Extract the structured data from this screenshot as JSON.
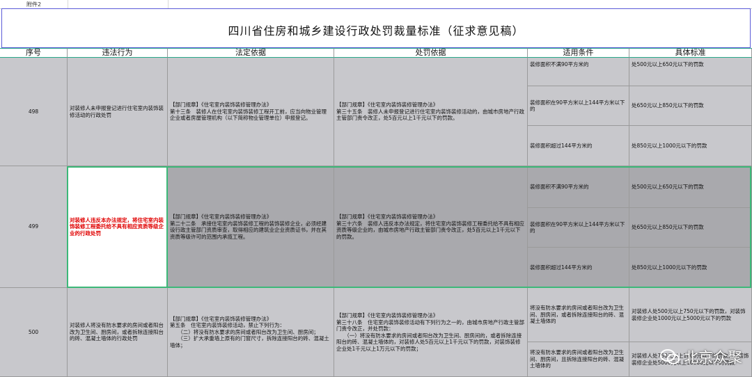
{
  "attachment_label": "附件2",
  "title": "四川省住房和城乡建设行政处罚裁量标准（征求意见稿）",
  "headers": [
    "序号",
    "违法行为",
    "法定依据",
    "处罚依据",
    "适用条件",
    "具体标准"
  ],
  "rows": [
    {
      "no": "498",
      "violation": "对装修人未申报登记进行住宅室内装饰装修活动的行政处罚",
      "legal_basis": "【部门规章】《住宅室内装饰装修管理办法》\n第十三条　装修人在住宅室内装饰装修工程开工前，应当向物业管理企业或者房屋管理机构（以下简称物业管理单位）申报登记。",
      "penalty_basis": "【部门规章】《住宅室内装饰装修管理办法》\n第三十五条　装修人未申报登记进行住宅室内装饰装修活动的，由城市房地产行政主管部门责令改正，处5百元以上1千元以下的罚款。",
      "conditions": [
        {
          "cond": "装修面积不满90平方米的",
          "std": "处500元以上650元以下的罚款"
        },
        {
          "cond": "装修面积在90平方米以上144平方米以下的",
          "std": "处650元以上850元以下的罚款"
        },
        {
          "cond": "装修面积超过144平方米的",
          "std": "处850元以上1000元以下的罚款"
        }
      ]
    },
    {
      "no": "499",
      "violation": "对装修人违反本办法规定，将住宅室内装饰装修工程委托给不具有相应资质等级企业的行政处罚",
      "legal_basis": "【部门规章】《住宅室内装饰装修管理办法》\n第二十二条　承接住宅室内装饰装修工程的装饰装修企业，必须经建设行政主管部门资质审查，取得相应的建筑业企业资质证书，并在其资质等级许可的范围内承揽工程。",
      "penalty_basis": "【部门规章】《住宅室内装饰装修管理办法》\n第三十六条　装修人违反本办法规定，将住宅室内装饰装修工程委托给不具有相应资质等级企业的，由城市房地产行政主管部门责令改正，处5百元以上1千元以下的罚款。",
      "conditions": [
        {
          "cond": "装修面积不满90平方米的",
          "std": "处500元以上650元以下的罚款"
        },
        {
          "cond": "装修面积在90平方米以上144平方米以下的",
          "std": "处650元以上850元以下的罚款"
        },
        {
          "cond": "装修面积超过144平方米的",
          "std": "处850元以上1000元以下的罚款"
        }
      ]
    },
    {
      "no": "500",
      "violation": "对装修人将没有防水要求的房间或者阳台改为卫生间、厨房间，或者拆除连接阳台的砖、混凝土墙体的行政处罚",
      "legal_basis": "【部门规章】《住宅室内装饰装修管理办法》\n第五条　住宅室内装饰装修活动，禁止下列行为：\n　　（二）将没有防水要求的房间或者阳台改为卫生间、厨房间；\n　　（三）扩大承重墙上原有的门窗尺寸，拆除连接阳台的砖、混凝土墙体；",
      "penalty_basis": "【部门规章】《住宅室内装饰装修管理办法》\n第三十八条　住宅室内装饰装修活动有下列行为之一的，由城市房地产行政主管部门责令改正，并处罚款：\n　　（一）将没有防水要求的房间或者阳台改为卫生间、厨房间的，或者拆除连接阳台的砖、混凝土墙体的，对装修人处5百元以上1千元以下的罚款，对装饰装修企业处1千元以上1万元以下的罚款；",
      "conditions": [
        {
          "cond": "将没有防水要求的房间或者阳台改为卫生间、厨房间，或者拆除连接阳台的砖、混凝土墙体的",
          "std": "对装修人处500元以上750元以下的罚款，对装饰装修企业处1000元以上5000元以下的罚款"
        },
        {
          "cond": "将没有防水要求的房间或者阳台改为卫生间、厨房间，且拆除连接阳台的砖、混凝土墙体的",
          "std": "对装修人处750元以上1000元以下的罚款，对装饰装修企业处5000元以上10000元以下的罚款"
        }
      ]
    }
  ],
  "watermark": "北京众聚",
  "colors": {
    "row_gray": "#c8c8cc",
    "row_selected": "#a9a9ad",
    "selection": "#3cb878",
    "title_border": "#5a5ad8",
    "red_text": "#e00000"
  }
}
